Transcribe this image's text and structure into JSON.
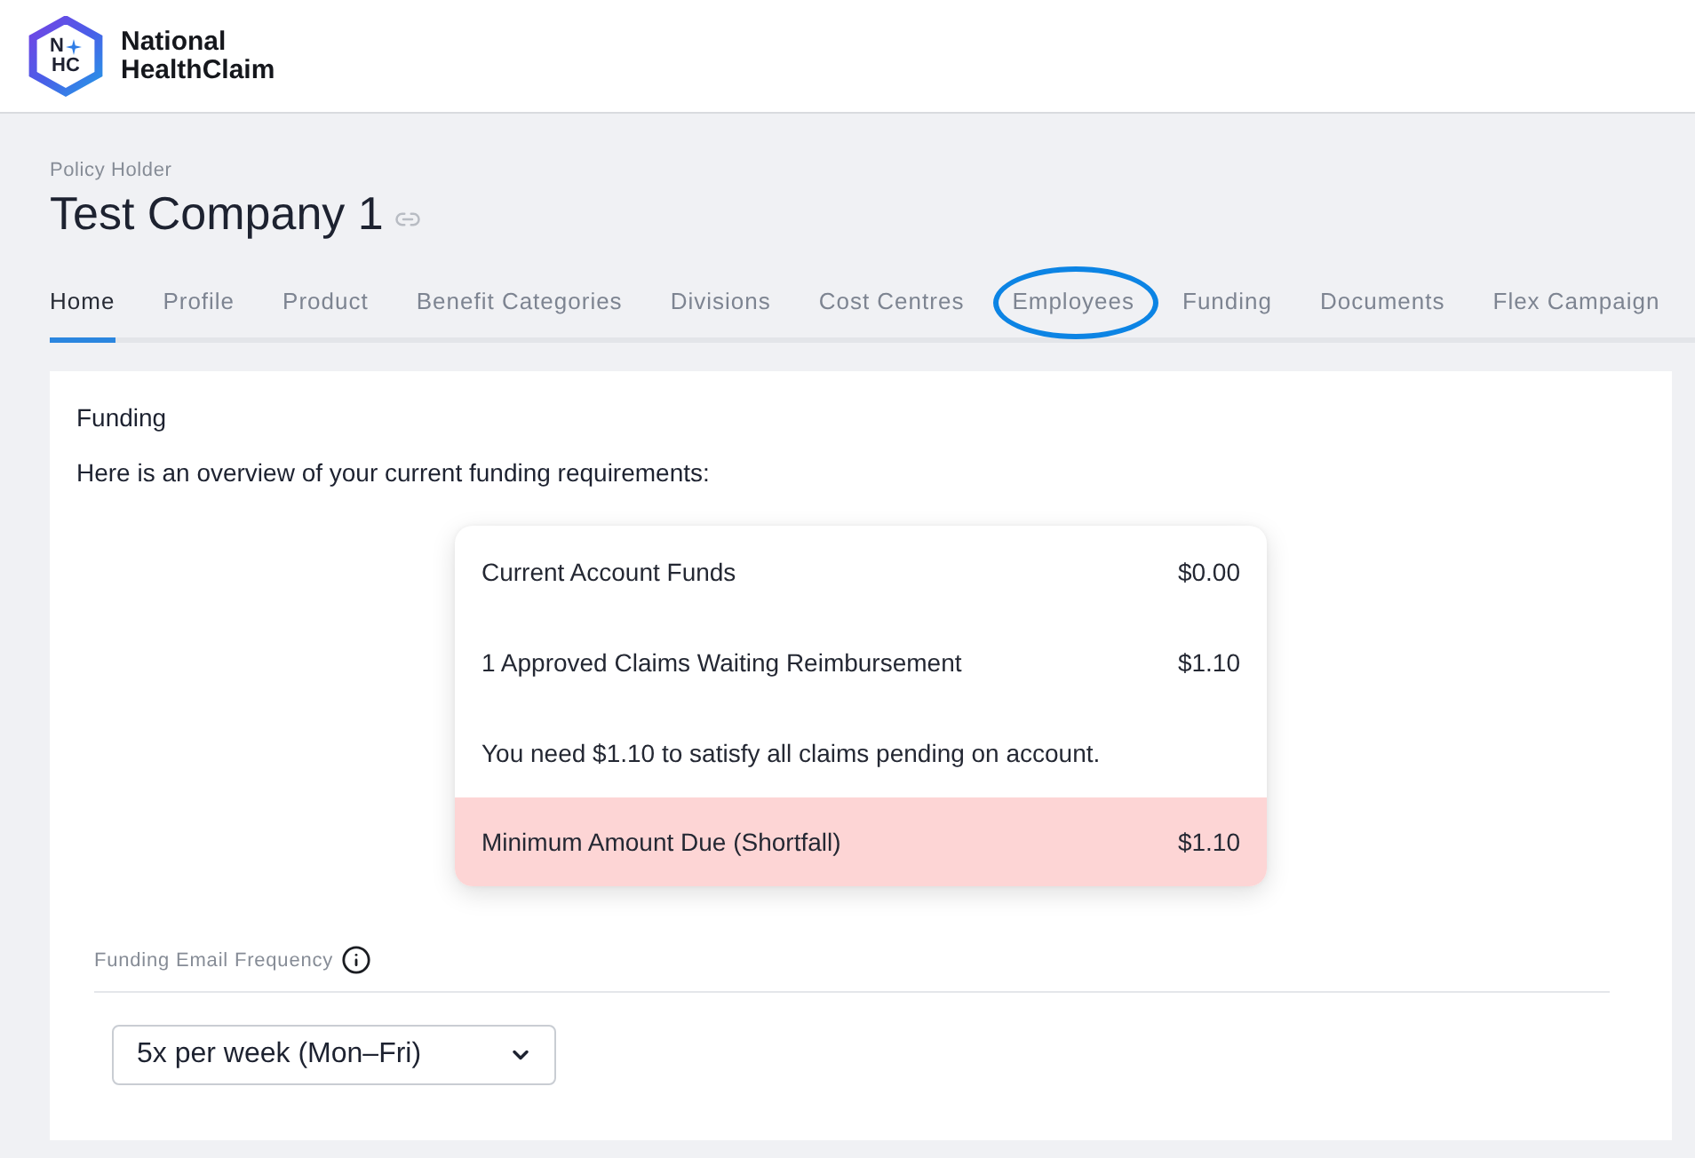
{
  "header": {
    "logo": {
      "mark_top": "N",
      "mark_bottom": "HC",
      "name_lines": [
        "National",
        "HealthClaim"
      ]
    }
  },
  "page_header": {
    "eyebrow": "Policy Holder",
    "title": "Test Company 1"
  },
  "tabs": [
    {
      "label": "Home",
      "selected": true,
      "highlighted": false
    },
    {
      "label": "Profile",
      "selected": false,
      "highlighted": false
    },
    {
      "label": "Product",
      "selected": false,
      "highlighted": false
    },
    {
      "label": "Benefit Categories",
      "selected": false,
      "highlighted": false
    },
    {
      "label": "Divisions",
      "selected": false,
      "highlighted": false
    },
    {
      "label": "Cost Centres",
      "selected": false,
      "highlighted": false
    },
    {
      "label": "Employees",
      "selected": false,
      "highlighted": true
    },
    {
      "label": "Funding",
      "selected": false,
      "highlighted": false
    },
    {
      "label": "Documents",
      "selected": false,
      "highlighted": false
    },
    {
      "label": "Flex Campaign",
      "selected": false,
      "highlighted": false
    }
  ],
  "card": {
    "title": "Funding",
    "intro": "Here is an overview of your current funding requirements:",
    "summary": {
      "rows": [
        {
          "kind": "amount",
          "label": "Current Account Funds",
          "value": "$0.00"
        },
        {
          "kind": "amount",
          "label": "1 Approved Claims Waiting Reimbursement",
          "value": "$1.10"
        },
        {
          "kind": "note",
          "text": "You need $1.10 to satisfy all claims pending on account."
        },
        {
          "kind": "shortfall",
          "label": "Minimum Amount Due (Shortfall)",
          "value": "$1.10"
        }
      ]
    },
    "email_frequency": {
      "label": "Funding Email Frequency",
      "value": "5x per week (Mon–Fri)"
    }
  }
}
